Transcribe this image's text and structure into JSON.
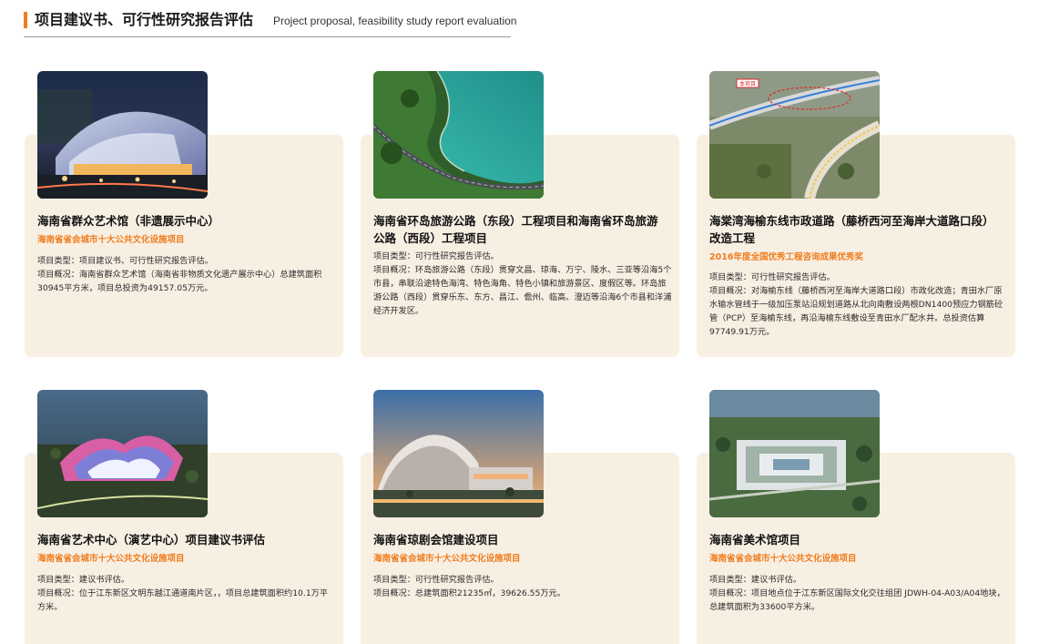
{
  "header": {
    "title": "项目建议书、可行性研究报告评估",
    "subtitle": "Project proposal, feasibility study report evaluation"
  },
  "cards": [
    {
      "title": "海南省群众艺术馆（非遗展示中心）",
      "tag": "海南省省会城市十大公共文化设施项目",
      "type": "项目类型：项目建议书、可行性研究报告评估。",
      "overview": "项目概况：海南省群众艺术馆（海南省非物质文化遗产展示中心）总建筑面积30945平方米，项目总投资为49157.05万元。",
      "image": "night-building-photo"
    },
    {
      "title": "海南省环岛旅游公路（东段）工程项目和海南省环岛旅游公路（西段）工程项目",
      "tag": "",
      "type": "项目类型：可行性研究报告评估。",
      "overview": "项目概况：环岛旅游公路（东段）贯穿文昌、琼海、万宁、陵水、三亚等沿海5个市县，串联沿途特色海湾、特色海角、特色小镇和旅游景区、度假区等。环岛旅游公路（西段）贯穿乐东、东方、昌江、儋州、临高、澄迈等沿海6个市县和洋浦经济开发区。",
      "image": "coastal-road-photo"
    },
    {
      "title": "海棠湾海榆东线市政道路（藤桥西河至海岸大道路口段）改造工程",
      "tag": "2016年度全国优秀工程咨询成果优秀奖",
      "type": "项目类型：可行性研究报告评估。",
      "overview": "项目概况：对海榆东线（藤桥西河至海岸大道路口段）市政化改造；青田水厂原水输水管线于一级加压泵站沿规划道路从北向南敷设两根DN1400预应力钢筋砼管（PCP）至海榆东线，再沿海榆东线敷设至青田水厂配水井。总投资估算97749.91万元。",
      "image": "aerial-interchange-photo",
      "map_label": "本项目"
    },
    {
      "title": "海南省艺术中心（演艺中心）项目建议书评估",
      "tag": "海南省省会城市十大公共文化设施项目",
      "type": "项目类型：建议书评估。",
      "overview": "项目概况：位于江东新区文明东越江通道南片区，，项目总建筑面积约10.1万平方米。",
      "image": "art-center-photo"
    },
    {
      "title": "海南省琼剧会馆建设项目",
      "tag": "海南省省会城市十大公共文化设施项目",
      "type": "项目类型：可行性研究报告评估。",
      "overview": "项目概况：总建筑面积21235㎡，39626.55万元。",
      "image": "opera-house-photo"
    },
    {
      "title": "海南省美术馆项目",
      "tag": "海南省省会城市十大公共文化设施项目",
      "type": "项目类型：建议书评估。",
      "overview": "项目概况：项目地点位于江东新区国际文化交往组团 JDWH-04-A03/A04地块，总建筑面积为33600平方米。",
      "image": "art-museum-photo"
    }
  ]
}
